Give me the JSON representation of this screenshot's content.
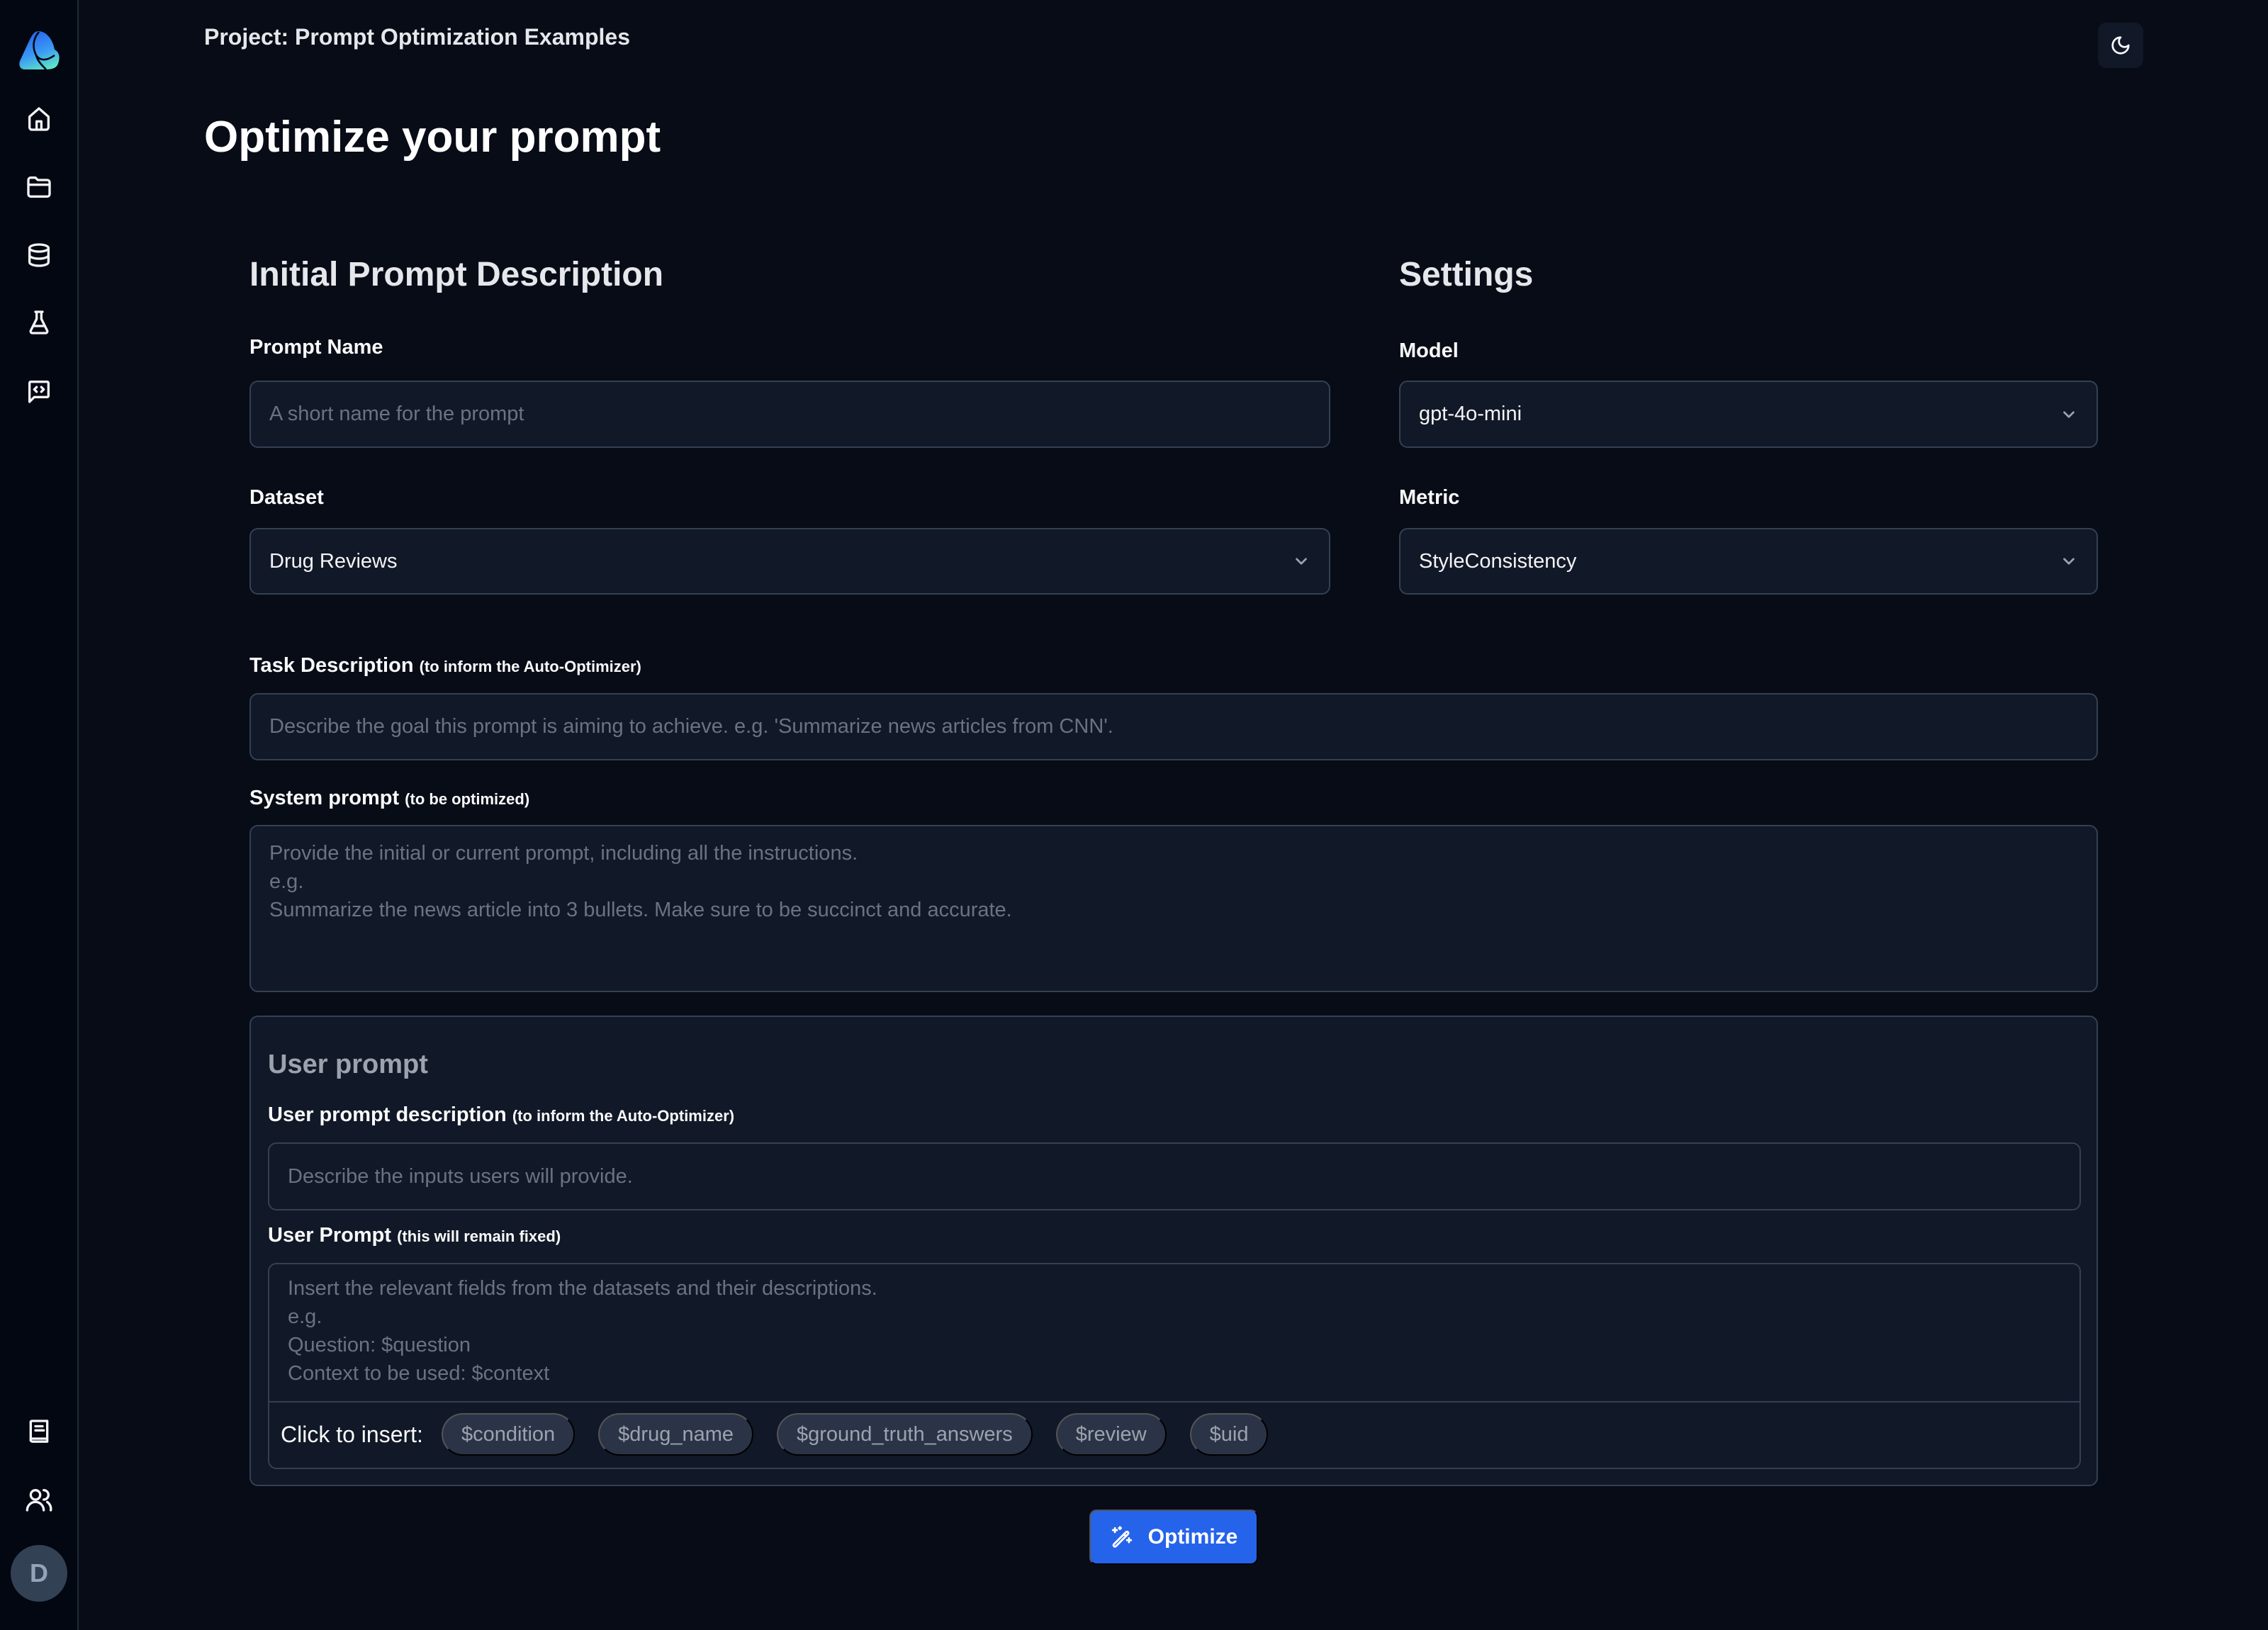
{
  "sidebar": {
    "nav": [
      {
        "name": "home",
        "icon": "home-icon"
      },
      {
        "name": "projects",
        "icon": "folder-icon"
      },
      {
        "name": "datasets",
        "icon": "database-icon"
      },
      {
        "name": "experiments",
        "icon": "flask-icon"
      },
      {
        "name": "prompts",
        "icon": "message-code-icon"
      }
    ],
    "bottom": [
      {
        "name": "docs",
        "icon": "book-icon"
      },
      {
        "name": "team",
        "icon": "users-icon"
      }
    ],
    "avatar_initial": "D"
  },
  "header": {
    "project_title": "Project: Prompt Optimization Examples",
    "theme_icon": "moon-icon"
  },
  "page": {
    "title": "Optimize your prompt"
  },
  "initial_prompt": {
    "section_title": "Initial Prompt Description",
    "prompt_name": {
      "label": "Prompt Name",
      "value": "",
      "placeholder": "A short name for the prompt"
    },
    "dataset": {
      "label": "Dataset",
      "selected": "Drug Reviews"
    },
    "task_description": {
      "label": "Task Description",
      "hint": "(to inform the Auto-Optimizer)",
      "value": "",
      "placeholder": "Describe the goal this prompt is aiming to achieve. e.g. 'Summarize news articles from CNN'."
    },
    "system_prompt": {
      "label": "System prompt",
      "hint": "(to be optimized)",
      "value": "",
      "placeholder": "Provide the initial or current prompt, including all the instructions.\ne.g.\nSummarize the news article into 3 bullets. Make sure to be succinct and accurate."
    }
  },
  "settings": {
    "section_title": "Settings",
    "model": {
      "label": "Model",
      "selected": "gpt-4o-mini"
    },
    "metric": {
      "label": "Metric",
      "selected": "StyleConsistency"
    }
  },
  "user_prompt": {
    "card_title": "User prompt",
    "description": {
      "label": "User prompt description",
      "hint": "(to inform the Auto-Optimizer)",
      "value": "",
      "placeholder": "Describe the inputs users will provide."
    },
    "prompt": {
      "label": "User Prompt",
      "hint": "(this will remain fixed)",
      "value": "",
      "placeholder": "Insert the relevant fields from the datasets and their descriptions.\ne.g.\nQuestion: $question\nContext to be used: $context"
    },
    "insert_label": "Click to insert:",
    "variables": [
      "$condition",
      "$drug_name",
      "$ground_truth_answers",
      "$review",
      "$uid"
    ]
  },
  "actions": {
    "optimize_label": "Optimize",
    "optimize_icon": "magic-wand-icon"
  },
  "colors": {
    "background": "#080c16",
    "sidebar": "#030712",
    "field": "#111827",
    "border": "#334155",
    "accent": "#2563eb",
    "chip": "#2b3447"
  }
}
